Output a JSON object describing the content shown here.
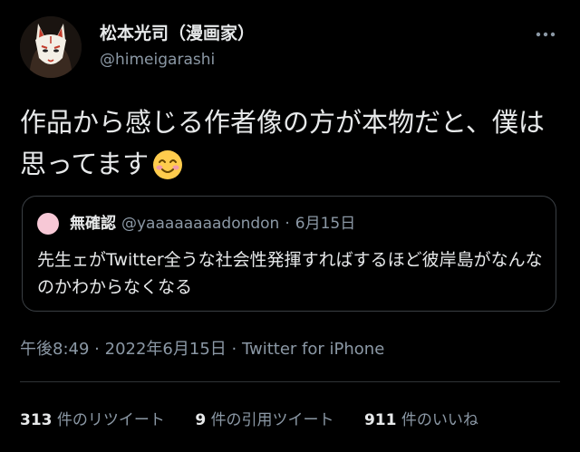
{
  "author": {
    "display_name": "松本光司（漫画家）",
    "handle": "@himeigarashi",
    "avatar_icon": "fox-mask-avatar"
  },
  "tweet": {
    "text": "作品から感じる作者像の方が本物だと、僕は思ってます",
    "emoji": "smiling-face-with-smiling-eyes"
  },
  "quoted_tweet": {
    "display_name": "無確認",
    "handle": "@yaaaaaaaadondon",
    "separator": "·",
    "date": "6月15日",
    "text": "先生ェがTwitter全うな社会性発揮すればするほど彼岸島がなんなのかわからなくなる"
  },
  "meta": {
    "time": "午後8:49",
    "sep1": "·",
    "date": "2022年6月15日",
    "sep2": "·",
    "source": "Twitter for iPhone"
  },
  "stats": {
    "retweets_count": "313",
    "retweets_label": "件のリツイート",
    "quotes_count": "9",
    "quotes_label": "件の引用ツイート",
    "likes_count": "911",
    "likes_label": "件のいいね"
  },
  "colors": {
    "background": "#000000",
    "text_primary": "#e7e9ea",
    "text_secondary": "#8b98a5",
    "border": "#2f3336"
  }
}
